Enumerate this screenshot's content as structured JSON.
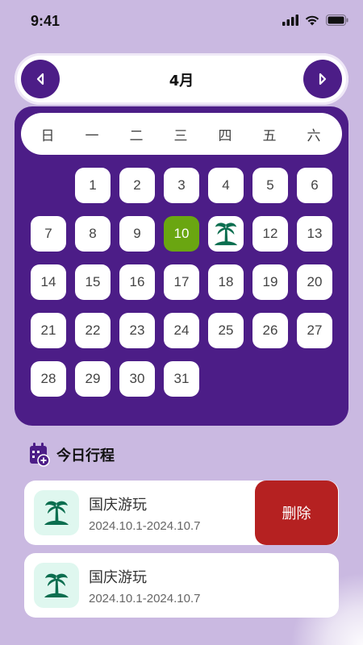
{
  "status_bar": {
    "time": "9:41"
  },
  "calendar": {
    "month": "4月",
    "weekdays": [
      "日",
      "一",
      "二",
      "三",
      "四",
      "五",
      "六"
    ],
    "weeks": [
      [
        null,
        1,
        2,
        3,
        4,
        5,
        6
      ],
      [
        7,
        8,
        9,
        10,
        11,
        12,
        13
      ],
      [
        14,
        15,
        16,
        17,
        18,
        19,
        20
      ],
      [
        21,
        22,
        23,
        24,
        25,
        26,
        27
      ],
      [
        28,
        29,
        30,
        31,
        null,
        null,
        null
      ]
    ],
    "today": 10,
    "event_day": 11,
    "event_day_icon": "palm-tree-icon"
  },
  "schedule": {
    "title": "今日行程",
    "icon": "calendar-add-icon",
    "events": [
      {
        "title": "国庆游玩",
        "dates": "2024.10.1-2024.10.7",
        "icon": "palm-tree-icon"
      },
      {
        "title": "国庆游玩",
        "dates": "2024.10.1-2024.10.7",
        "icon": "palm-tree-icon"
      }
    ],
    "delete_label": "删除"
  },
  "colors": {
    "background": "#cab9e1",
    "primary": "#4c1d87",
    "today": "#6aa611",
    "delete": "#b52121",
    "event_icon_bg": "#dff7ef",
    "palm": "#0b6e4f"
  }
}
